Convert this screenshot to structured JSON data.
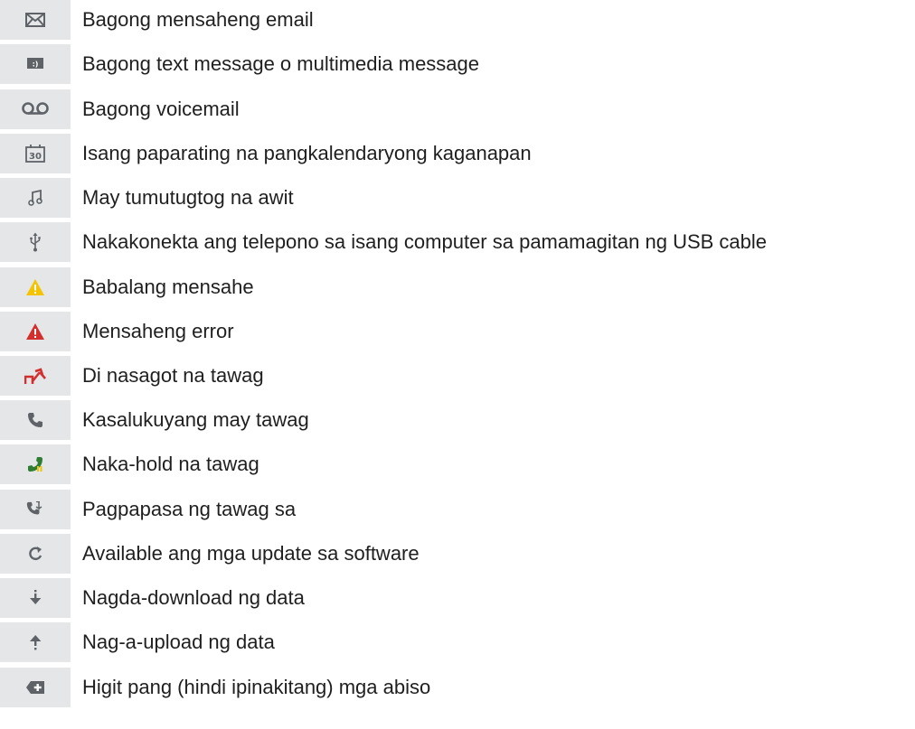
{
  "items": [
    {
      "icon": "email-envelope-icon",
      "label": "Bagong mensaheng email"
    },
    {
      "icon": "sms-message-icon",
      "label": "Bagong text message o multimedia message"
    },
    {
      "icon": "voicemail-icon",
      "label": "Bagong voicemail"
    },
    {
      "icon": "calendar-30-icon",
      "label": "Isang paparating na pangkalendaryong kaganapan"
    },
    {
      "icon": "music-note-icon",
      "label": "May tumutugtog na awit"
    },
    {
      "icon": "usb-icon",
      "label": "Nakakonekta ang telepono sa isang computer sa pamamagitan ng USB cable"
    },
    {
      "icon": "warning-yellow-icon",
      "label": "Babalang mensahe"
    },
    {
      "icon": "error-red-icon",
      "label": "Mensaheng error"
    },
    {
      "icon": "missed-call-icon",
      "label": "Di nasagot na tawag"
    },
    {
      "icon": "call-in-progress-icon",
      "label": "Kasalukuyang may tawag"
    },
    {
      "icon": "call-on-hold-icon",
      "label": "Naka-hold na tawag"
    },
    {
      "icon": "call-forward-icon",
      "label": "Pagpapasa ng tawag sa"
    },
    {
      "icon": "software-update-icon",
      "label": "Available ang mga update sa software"
    },
    {
      "icon": "download-icon",
      "label": "Nagda-download ng data"
    },
    {
      "icon": "upload-icon",
      "label": "Nag-a-upload ng data"
    },
    {
      "icon": "more-notifications-icon",
      "label": "Higit pang (hindi ipinakitang) mga abiso"
    }
  ],
  "colors": {
    "icon_background": "#e4e6e8",
    "icon_gray": "#5f6368",
    "warning_yellow": "#f5c400",
    "error_red": "#d32f2f",
    "hold_green": "#2e7d32"
  }
}
